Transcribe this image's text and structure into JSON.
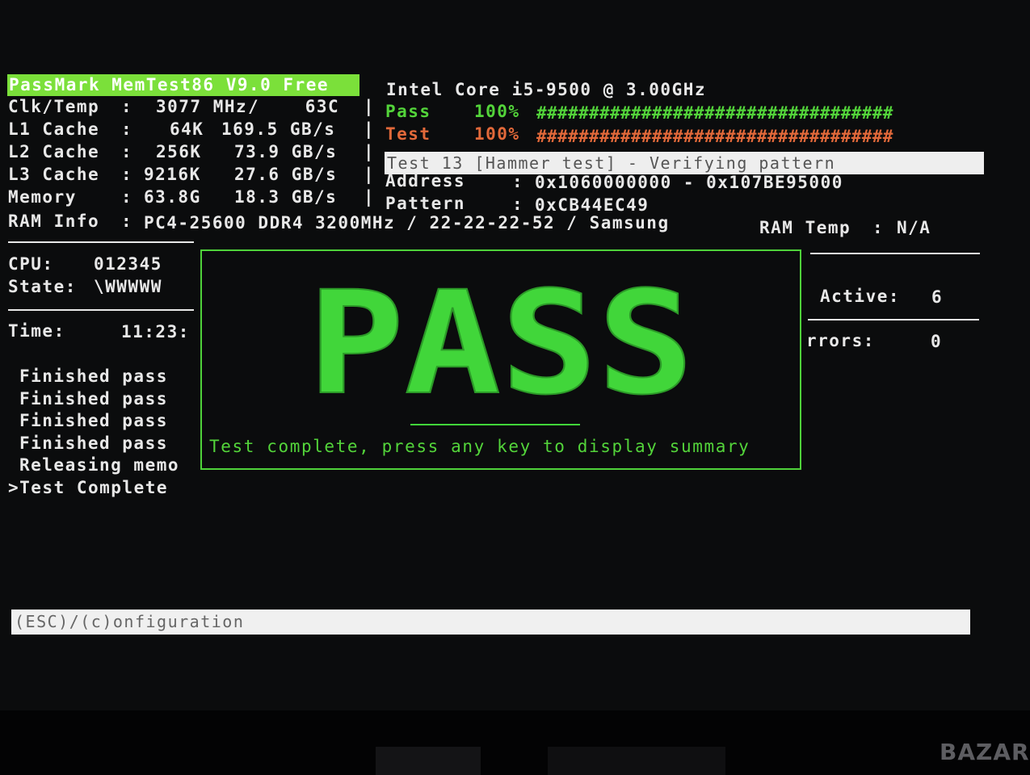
{
  "header": {
    "title": "PassMark MemTest86 V9.0 Free",
    "cpu_name": "Intel Core i5-9500 @ 3.00GHz"
  },
  "specs": [
    {
      "label": "Clk/Temp",
      "size": "3077 MHz",
      "speed": "/    63C"
    },
    {
      "label": "L1 Cache",
      "size": "64K",
      "speed": "169.5 GB/s"
    },
    {
      "label": "L2 Cache",
      "size": "256K",
      "speed": "73.9 GB/s"
    },
    {
      "label": "L3 Cache",
      "size": "9216K",
      "speed": "27.6 GB/s"
    },
    {
      "label": "Memory",
      "size": "63.8G",
      "speed": "18.3 GB/s"
    }
  ],
  "ram_info": {
    "label": "RAM Info",
    "value": "PC4-25600 DDR4 3200MHz / 22-22-22-52 / Samsung"
  },
  "ram_temp": {
    "label": "RAM Temp",
    "value": "N/A"
  },
  "progress": {
    "pass_label": "Pass",
    "pass_percent": "100%",
    "pass_fraction": 1.0,
    "test_label": "Test",
    "test_percent": "100%",
    "test_fraction": 1.0,
    "hashes": "##################################"
  },
  "current_test": "Test 13 [Hammer test] - Verifying pattern",
  "address": {
    "label": "Address",
    "value": "0x1060000000 - 0x107BE95000"
  },
  "pattern": {
    "label": "Pattern",
    "value": "0xCB44EC49"
  },
  "left_panel": {
    "cpu_label": "CPU:",
    "cpu_value": "012345",
    "state_label": "State:",
    "state_value": "\\WWWWW",
    "time_label": "Time:",
    "time_value": "11:23:",
    "log": [
      "Finished pass",
      "Finished pass",
      "Finished pass",
      "Finished pass",
      "Releasing memo",
      ">Test Complete"
    ]
  },
  "right_panel": {
    "active_label": "Active:",
    "active_value": "6",
    "errors_label": "rrors:",
    "errors_value": "0"
  },
  "result": {
    "big_text": "PASS",
    "message": "Test complete, press any key to display summary"
  },
  "footer": {
    "hint": "(ESC)/(c)onfiguration"
  },
  "watermark": "BAZAR",
  "colors": {
    "pass_green": "#53d43a",
    "fail_orange": "#e2693a",
    "title_bg": "#7be03a"
  }
}
